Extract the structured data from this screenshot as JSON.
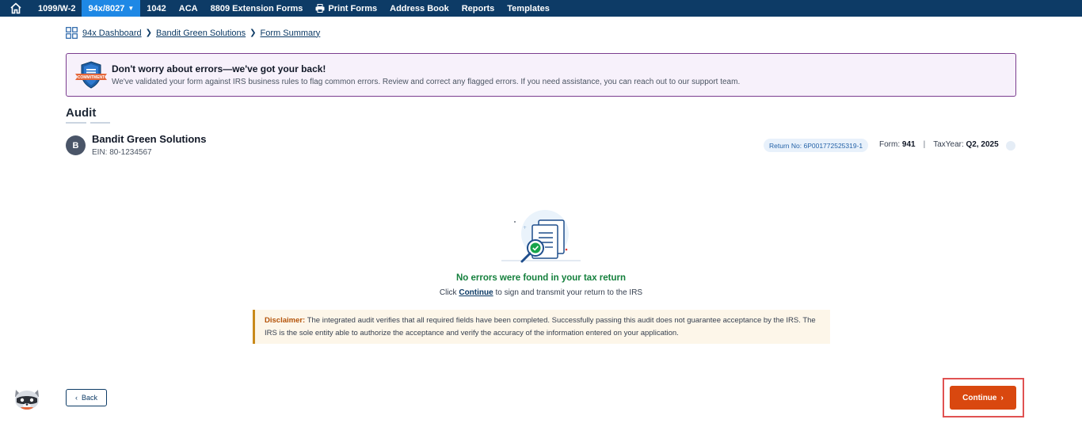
{
  "nav": {
    "items": [
      {
        "label": "1099/W-2"
      },
      {
        "label": "94x/8027",
        "active": true
      },
      {
        "label": "1042"
      },
      {
        "label": "ACA"
      },
      {
        "label": "8809 Extension Forms"
      },
      {
        "label": "Print Forms",
        "icon": "printer-icon"
      },
      {
        "label": "Address Book"
      },
      {
        "label": "Reports"
      },
      {
        "label": "Templates"
      }
    ]
  },
  "breadcrumb": {
    "items": [
      "94x Dashboard",
      "Bandit Green Solutions",
      "Form Summary"
    ]
  },
  "banner": {
    "badge_text": "COMMITMENT",
    "title": "Don't worry about errors—we've got your back!",
    "text": "We've validated your form against IRS business rules to flag common errors. Review and correct any flagged errors. If you need assistance, you can reach out to our support team."
  },
  "audit": {
    "title": "Audit"
  },
  "business": {
    "initial": "B",
    "name": "Bandit Green Solutions",
    "ein": "EIN: 80-1234567",
    "return_label": "Return No: 6P001772525319-1",
    "form_label": "Form:",
    "form_value": "941",
    "taxyear_label": "TaxYear:",
    "taxyear_value": "Q2, 2025"
  },
  "result": {
    "title": "No errors were found in your tax return",
    "sub_prefix": "Click",
    "sub_link": "Continue",
    "sub_suffix": "to sign and transmit your return to the IRS"
  },
  "disclaimer": {
    "label": "Disclaimer:",
    "text": "The integrated audit verifies that all required fields have been completed. Successfully passing this audit does not guarantee acceptance by the IRS. The IRS is the sole entity able to authorize the acceptance and verify the accuracy of the information entered on your application."
  },
  "actions": {
    "back_label": "Back",
    "continue_label": "Continue"
  },
  "colors": {
    "nav_bg": "#0d3b66",
    "nav_active": "#1e88e5",
    "accent_orange": "#d9480f",
    "success_green": "#15803d",
    "banner_border": "#7b3d8f"
  }
}
